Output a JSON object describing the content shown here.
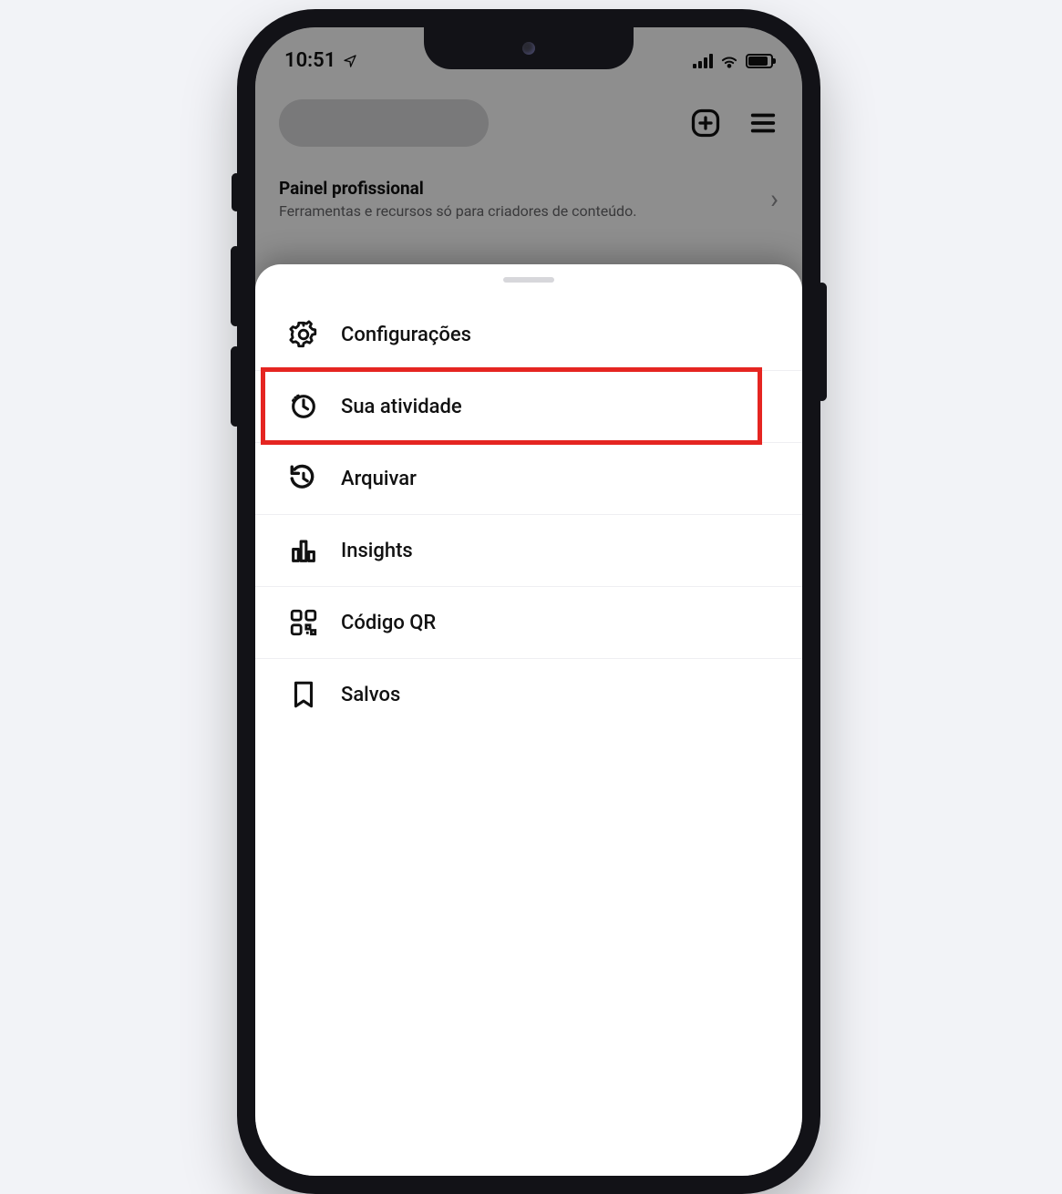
{
  "status_bar": {
    "time": "10:51"
  },
  "header": {
    "panel_title": "Painel profissional",
    "panel_subtitle": "Ferramentas e recursos só para criadores de conteúdo."
  },
  "menu": {
    "items": [
      {
        "label": "Configurações",
        "icon": "settings-icon"
      },
      {
        "label": "Sua atividade",
        "icon": "activity-icon"
      },
      {
        "label": "Arquivar",
        "icon": "archive-icon"
      },
      {
        "label": "Insights",
        "icon": "insights-icon"
      },
      {
        "label": "Código QR",
        "icon": "qr-code-icon"
      },
      {
        "label": "Salvos",
        "icon": "saved-icon"
      }
    ],
    "highlighted_index": 1
  }
}
